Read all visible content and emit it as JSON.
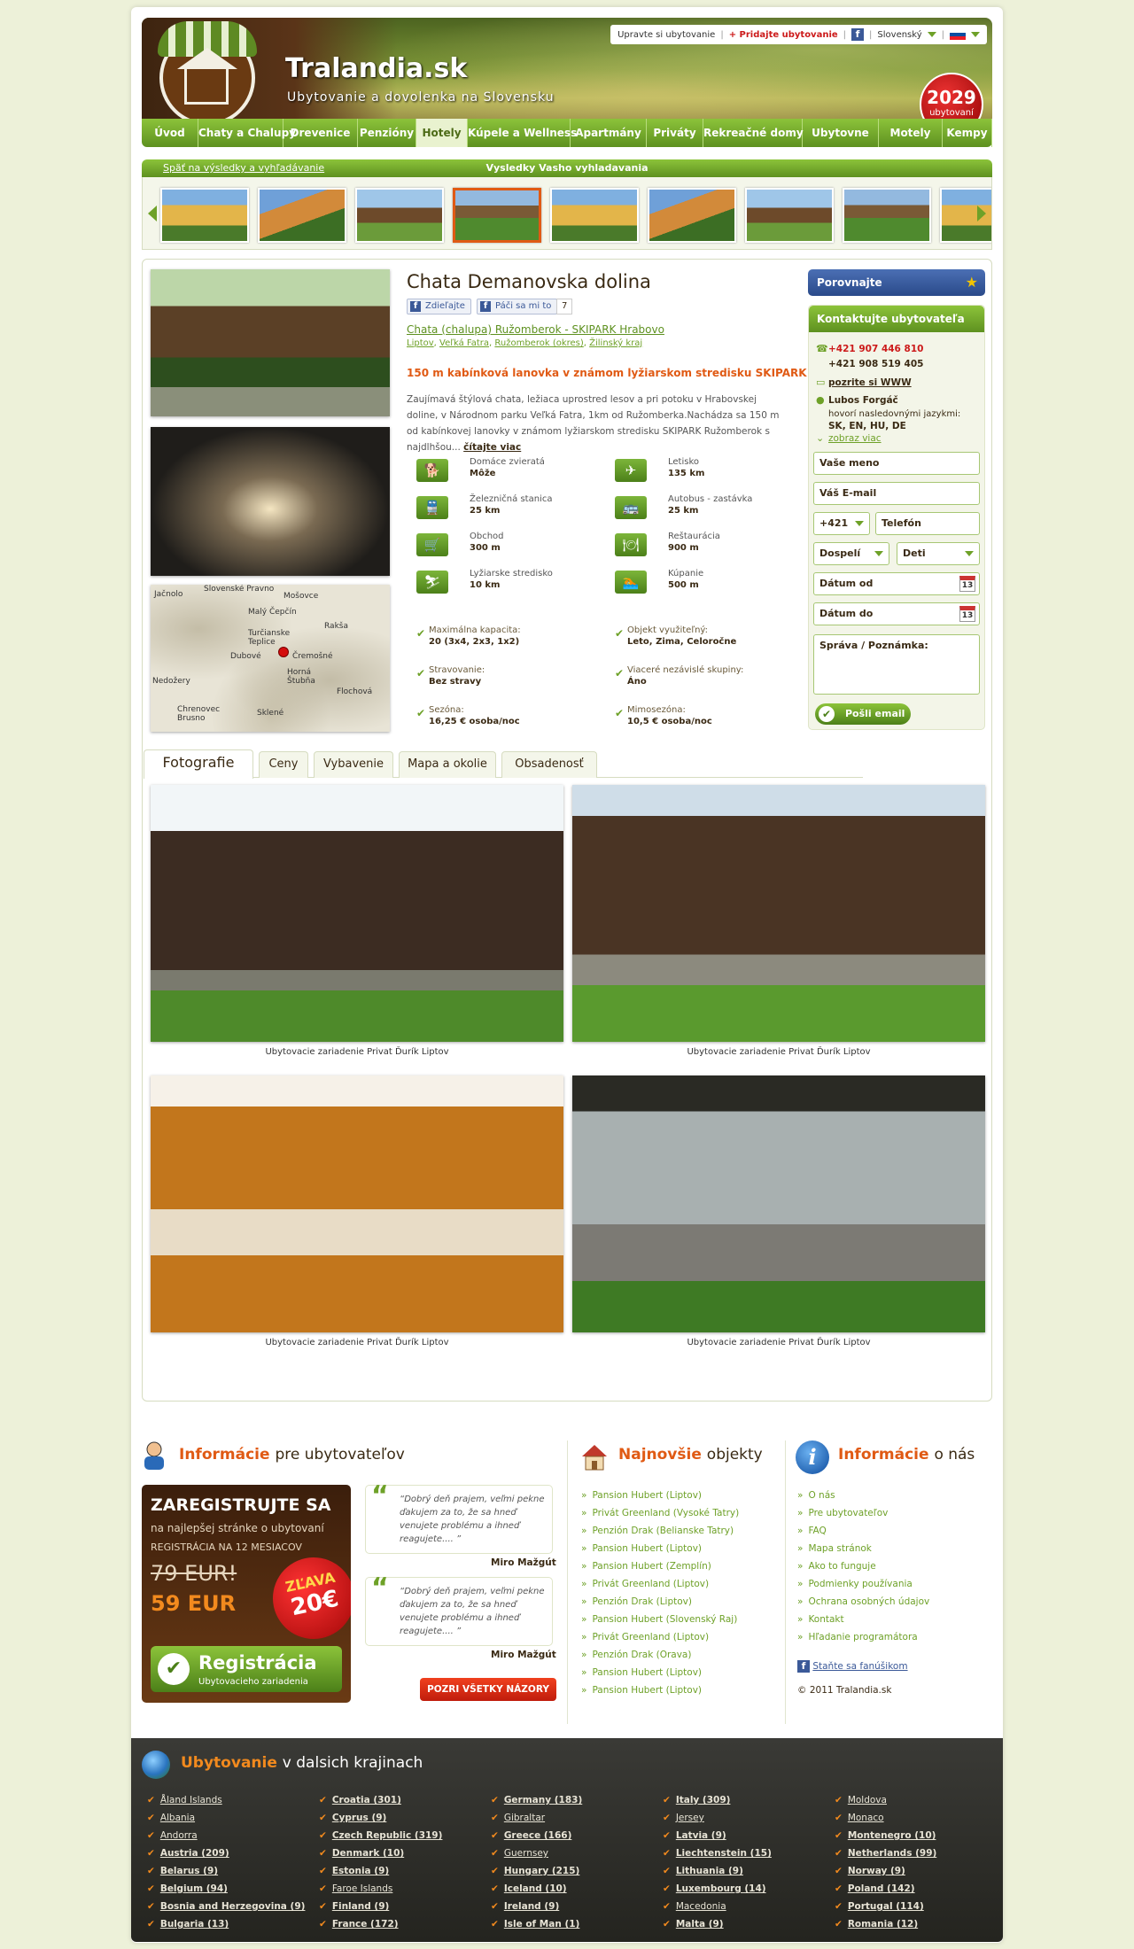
{
  "header": {
    "site_name": "Tralandia.sk",
    "tagline": "Ubytovanie a dovolenka na Slovensku",
    "top_links": {
      "edit": "Upravte si ubytovanie",
      "add": "+ Pridajte ubytovanie",
      "lang": "Slovenský"
    },
    "badge_count": "2029",
    "badge_label": "ubytovaní"
  },
  "nav": [
    "Úvod",
    "Chaty a Chalupy",
    "Drevenice",
    "Penzióny",
    "Hotely",
    "Kúpele a Wellness",
    "Apartmány",
    "Priváty",
    "Rekreačné domy",
    "Ubytovne",
    "Motely",
    "Kempy"
  ],
  "nav_active": 4,
  "results": {
    "back": "Späť na výsledky a vyhľadávanie",
    "title": "Vysledky Vasho vyhladavania"
  },
  "listing": {
    "title": "Chata Demanovska dolina",
    "share_label": "Zdieľajte",
    "like_label": "Páči sa mi to",
    "like_count": "7",
    "subtitle": "Chata (chalupa) Ružomberok - SKIPARK Hrabovo",
    "crumbs": [
      "Liptov",
      "Veľká Fatra",
      "Ružomberok (okres)",
      "Žilinský kraj"
    ],
    "promo": "150 m kabínková lanovka v známom lyžiarskom stredisku SKIPARK",
    "description": "Zaujímavá štýlová chata, ležiaca uprostred lesov a pri potoku v Hrabovskej doline, v Národnom parku Veľká Fatra, 1km od Ružomberka.Nachádza sa 150 m od kabínkovej lanovky v známom lyžiarskom stredisku SKIPARK Ružomberok s najdlhšou...",
    "read_more": "čítajte viac",
    "amenities": [
      {
        "icon": "pet-icon",
        "label": "Domáce zvieratá",
        "value": "Môže"
      },
      {
        "icon": "plane-icon",
        "label": "Letisko",
        "value": "135 km"
      },
      {
        "icon": "train-icon",
        "label": "Železničná stanica",
        "value": "25 km"
      },
      {
        "icon": "bus-icon",
        "label": "Autobus - zastávka",
        "value": "25 km"
      },
      {
        "icon": "cart-icon",
        "label": "Obchod",
        "value": "300 m"
      },
      {
        "icon": "restaurant-icon",
        "label": "Reštaurácia",
        "value": "900 m"
      },
      {
        "icon": "ski-icon",
        "label": "Lyžiarske stredisko",
        "value": "10 km"
      },
      {
        "icon": "swim-icon",
        "label": "Kúpanie",
        "value": "500 m"
      }
    ],
    "facts": [
      {
        "label": "Maximálna kapacita:",
        "value": "20 (3x4, 2x3, 1x2)"
      },
      {
        "label": "Objekt využiteľný:",
        "value": "Leto, Zima, Celoročne"
      },
      {
        "label": "Stravovanie:",
        "value": "Bez stravy"
      },
      {
        "label": "Viaceré nezávislé skupiny:",
        "value": "Áno"
      },
      {
        "label": "Sezóna:",
        "value": "16,25 € osoba/noc"
      },
      {
        "label": "Mimosezóna:",
        "value": "10,5 € osoba/noc"
      }
    ],
    "map_places": [
      "Jačnolo",
      "Slovenské Pravno",
      "Mošovce",
      "Malý Čepčín",
      "Turčianske Teplice",
      "Rakša",
      "Dubové",
      "Čremošné",
      "Horná Štubňa",
      "Nedožery",
      "Chrenovec Brusno",
      "Sklené",
      "Flochová"
    ]
  },
  "contact": {
    "compare": "Porovnajte",
    "title": "Kontaktujte ubytovateľa",
    "phone1": "+421 907 446 810",
    "phone2": "+421 908 519 405",
    "www": "pozrite si WWW",
    "owner": "Lubos Forgáč",
    "lang_note": "hovorí nasledovnými jazykmi:",
    "langs": "SK, EN, HU, DE",
    "show_more": "zobraz viac",
    "name_ph": "Vaše meno",
    "email_ph": "Váš E-mail",
    "prefix": "+421",
    "phone_ph": "Telefón",
    "adults": "Dospelí",
    "kids": "Deti",
    "date_from": "Dátum od",
    "date_to": "Dátum do",
    "message": "Správa / Poznámka:",
    "send": "Pošli email",
    "cal_day": "13"
  },
  "tabs": [
    "Fotografie",
    "Ceny",
    "Vybavenie",
    "Mapa a okolie",
    "Obsadenosť"
  ],
  "gallery_caption": "Ubytovacie zariadenie Privat Ďurík Liptov",
  "info": {
    "owners_title_a": "Informácie",
    "owners_title_b": "pre ubytovateľov",
    "reg_head": "ZAREGISTRUJTE SA",
    "reg_sub": "na najlepšej stránke o ubytovaní",
    "reg_months": "REGISTRÁCIA NA 12 MESIACOV",
    "old_price": "79 EUR!",
    "new_price": "59 EUR",
    "disc_a": "ZĽAVA",
    "disc_b": "20€",
    "reg_btn": "Registrácia",
    "reg_btn_sub": "Ubytovacieho zariadenia",
    "quote": "Dobrý deň prajem, veľmi pekne ďakujem za to, že sa hneď venujete problému a ihneď reagujete.... ",
    "quote_author": "Miro Mažgút",
    "all_reviews": "POZRI VŠETKY NÁZORY",
    "newest_title_a": "Najnovšie",
    "newest_title_b": "objekty",
    "newest": [
      "Pansion Hubert (Liptov)",
      "Privát Greenland (Vysoké Tatry)",
      "Penzión Drak (Belianske Tatry)",
      "Pansion Hubert (Liptov)",
      "Pansion Hubert (Zemplín)",
      "Privát Greenland (Liptov)",
      "Penzión Drak (Liptov)",
      "Pansion Hubert (Slovenský Raj)",
      "Privát Greenland (Liptov)",
      "Penzión Drak (Orava)",
      "Pansion Hubert (Liptov)",
      "Pansion Hubert (Liptov)"
    ],
    "about_title_a": "Informácie",
    "about_title_b": "o nás",
    "about": [
      "O nás",
      "Pre ubytovateľov",
      "FAQ",
      "Mapa stránok",
      "Ako to funguje",
      "Podmienky používania",
      "Ochrana osobných údajov",
      "Kontakt",
      "Hľadanie programátora"
    ],
    "fan": "Staňte sa fanúšikom",
    "copyright": "© 2011 Tralandia.sk"
  },
  "footer": {
    "title_a": "Ubytovanie",
    "title_b": "v dalsich krajinach",
    "columns": [
      [
        [
          "Åland Islands",
          false
        ],
        [
          "Albania",
          false
        ],
        [
          "Andorra",
          false
        ],
        [
          "Austria (209)",
          true
        ],
        [
          "Belarus (9)",
          true
        ],
        [
          "Belgium (94)",
          true
        ],
        [
          "Bosnia and Herzegovina (9)",
          true
        ],
        [
          "Bulgaria (13)",
          true
        ]
      ],
      [
        [
          "Croatia (301)",
          true
        ],
        [
          "Cyprus (9)",
          true
        ],
        [
          "Czech Republic (319)",
          true
        ],
        [
          "Denmark (10)",
          true
        ],
        [
          "Estonia (9)",
          true
        ],
        [
          "Faroe Islands",
          false
        ],
        [
          "Finland (9)",
          true
        ],
        [
          "France (172)",
          true
        ]
      ],
      [
        [
          "Germany (183)",
          true
        ],
        [
          "Gibraltar",
          false
        ],
        [
          "Greece (166)",
          true
        ],
        [
          "Guernsey",
          false
        ],
        [
          "Hungary (215)",
          true
        ],
        [
          "Iceland (10)",
          true
        ],
        [
          "Ireland (9)",
          true
        ],
        [
          "Isle of Man (1)",
          true
        ]
      ],
      [
        [
          "Italy (309)",
          true
        ],
        [
          "Jersey",
          false
        ],
        [
          "Latvia (9)",
          true
        ],
        [
          "Liechtenstein (15)",
          true
        ],
        [
          "Lithuania (9)",
          true
        ],
        [
          "Luxembourg (14)",
          true
        ],
        [
          "Macedonia",
          false
        ],
        [
          "Malta (9)",
          true
        ]
      ],
      [
        [
          "Moldova",
          false
        ],
        [
          "Monaco",
          false
        ],
        [
          "Montenegro (10)",
          true
        ],
        [
          "Netherlands (99)",
          true
        ],
        [
          "Norway (9)",
          true
        ],
        [
          "Poland (142)",
          true
        ],
        [
          "Portugal (114)",
          true
        ],
        [
          "Romania (12)",
          true
        ]
      ]
    ]
  }
}
